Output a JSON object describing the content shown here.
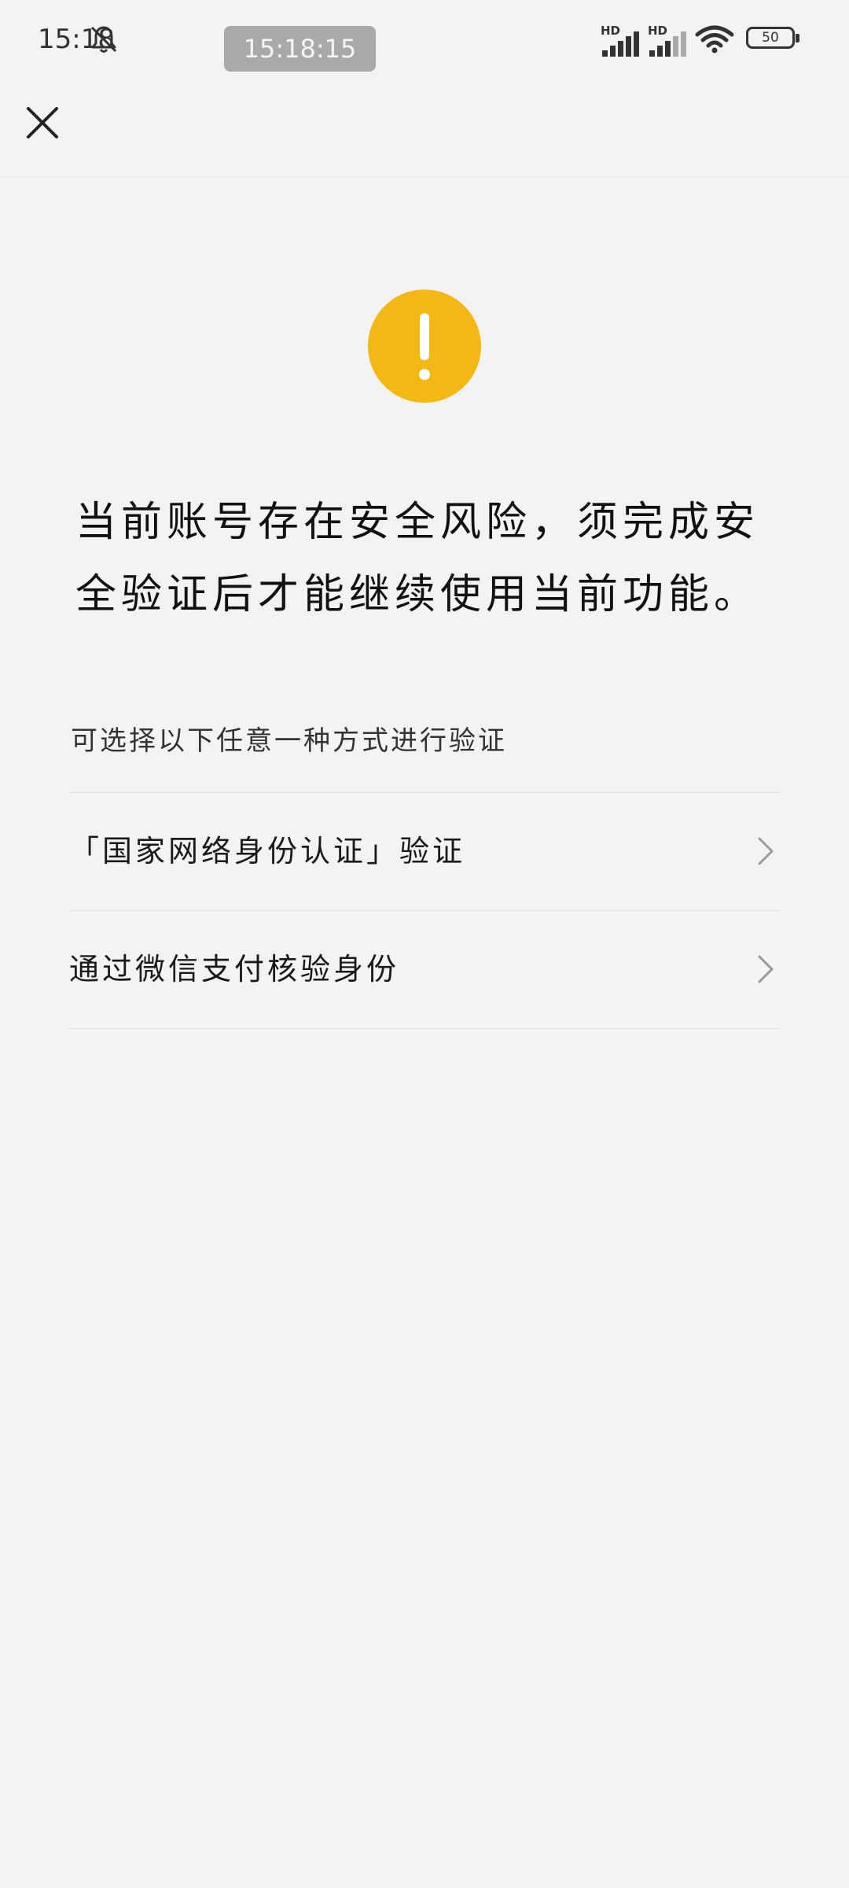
{
  "status_bar": {
    "time": "15:18",
    "clock_pill": "15:18:15",
    "signal_1_label": "HD",
    "signal_2_label": "HD",
    "battery_level": "50",
    "icons": [
      "bell-muted-icon",
      "signal-icon",
      "signal-icon",
      "wifi-icon",
      "battery-icon"
    ]
  },
  "nav": {
    "close_icon": "close-icon"
  },
  "warning": {
    "icon": "warning-icon",
    "color": "#f4b814",
    "message_line_1": "当前账号存在安全风险，须完成安",
    "message_line_2": "全验证后才能继续使用当前功能。"
  },
  "verification": {
    "sub_label": "可选择以下任意一种方式进行验证",
    "options": [
      {
        "label": "「国家网络身份认证」验证",
        "icon": "chevron-right-icon"
      },
      {
        "label": "通过微信支付核验身份",
        "icon": "chevron-right-icon"
      }
    ]
  }
}
